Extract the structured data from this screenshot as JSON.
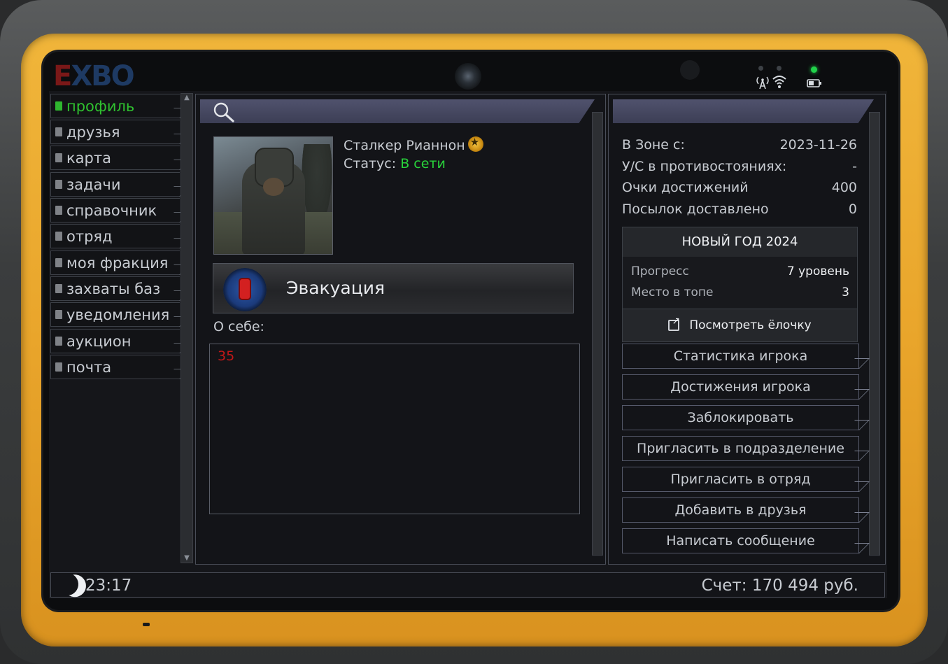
{
  "logo": {
    "left": "E",
    "mid": "X",
    "right": "BO"
  },
  "nav": [
    {
      "label": "профиль",
      "active": true
    },
    {
      "label": "друзья",
      "active": false
    },
    {
      "label": "карта",
      "active": false
    },
    {
      "label": "задачи",
      "active": false
    },
    {
      "label": "справочник",
      "active": false
    },
    {
      "label": "отряд",
      "active": false
    },
    {
      "label": "моя фракция",
      "active": false
    },
    {
      "label": "захваты баз",
      "active": false
    },
    {
      "label": "уведомления",
      "active": false
    },
    {
      "label": "аукцион",
      "active": false
    },
    {
      "label": "почта",
      "active": false
    }
  ],
  "profile": {
    "name": "Сталкер Рианнон",
    "status_label": "Статус:",
    "status_value": "В сети",
    "group": "Эвакуация",
    "about_label": "О себе:",
    "about_text": "35"
  },
  "stats": [
    {
      "label": "В Зоне с:",
      "value": "2023-11-26"
    },
    {
      "label": "У/С в противостояниях:",
      "value": "-"
    },
    {
      "label": "Очки достижений",
      "value": "400"
    },
    {
      "label": "Посылок доставлено",
      "value": "0"
    }
  ],
  "event": {
    "title": "НОВЫЙ ГОД 2024",
    "progress_label": "Прогресс",
    "progress_value": "7 уровень",
    "rank_label": "Место в топе",
    "rank_value": "3",
    "button": "Посмотреть ёлочку"
  },
  "actions": [
    "Статистика игрока",
    "Достижения игрока",
    "Заблокировать",
    "Пригласить в подразделение",
    "Пригласить в отряд",
    "Добавить в друзья",
    "Написать сообщение"
  ],
  "footer": {
    "time": "23:17",
    "balance": "Счет: 170 494 руб."
  },
  "colors": {
    "accent_green": "#2fc02f",
    "status_green": "#29d43b",
    "header_purple": "#4a4c66",
    "tablet_yellow": "#e9a52b"
  }
}
